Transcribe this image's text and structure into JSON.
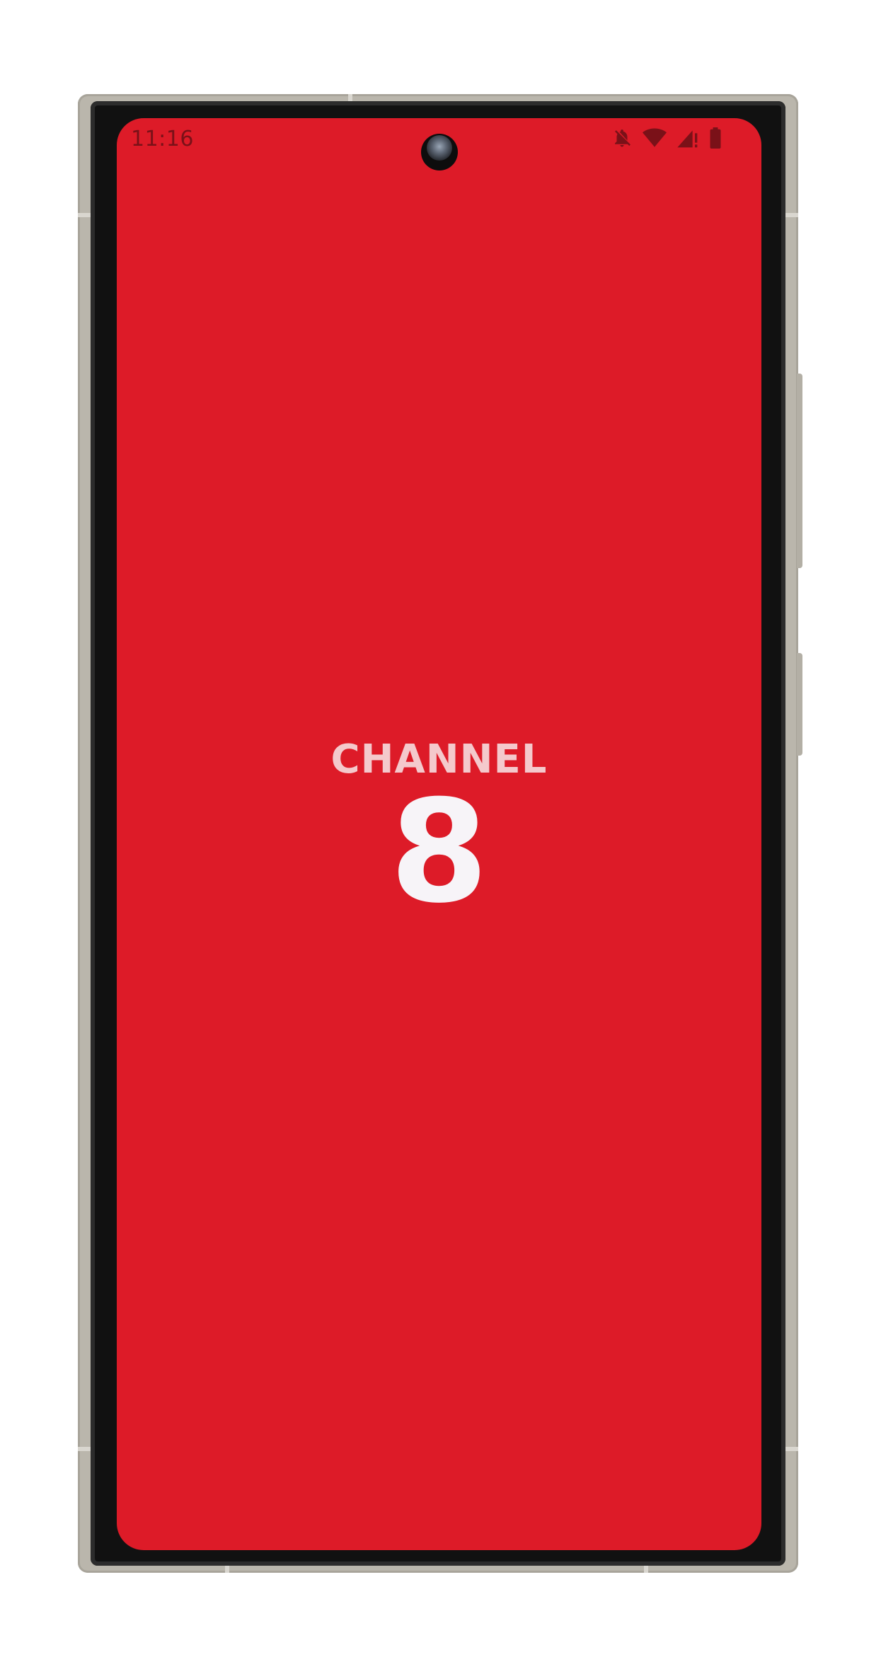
{
  "status_bar": {
    "time": "11:16",
    "icons": [
      "notifications-off-icon",
      "wifi-icon",
      "signal-icon",
      "battery-icon"
    ],
    "icon_color": "#7a1118"
  },
  "splash": {
    "logo_word": "CHANNEL",
    "logo_number": "8",
    "background_color": "#dd1b28"
  },
  "device": {
    "frame_color": "#bab6ac"
  }
}
